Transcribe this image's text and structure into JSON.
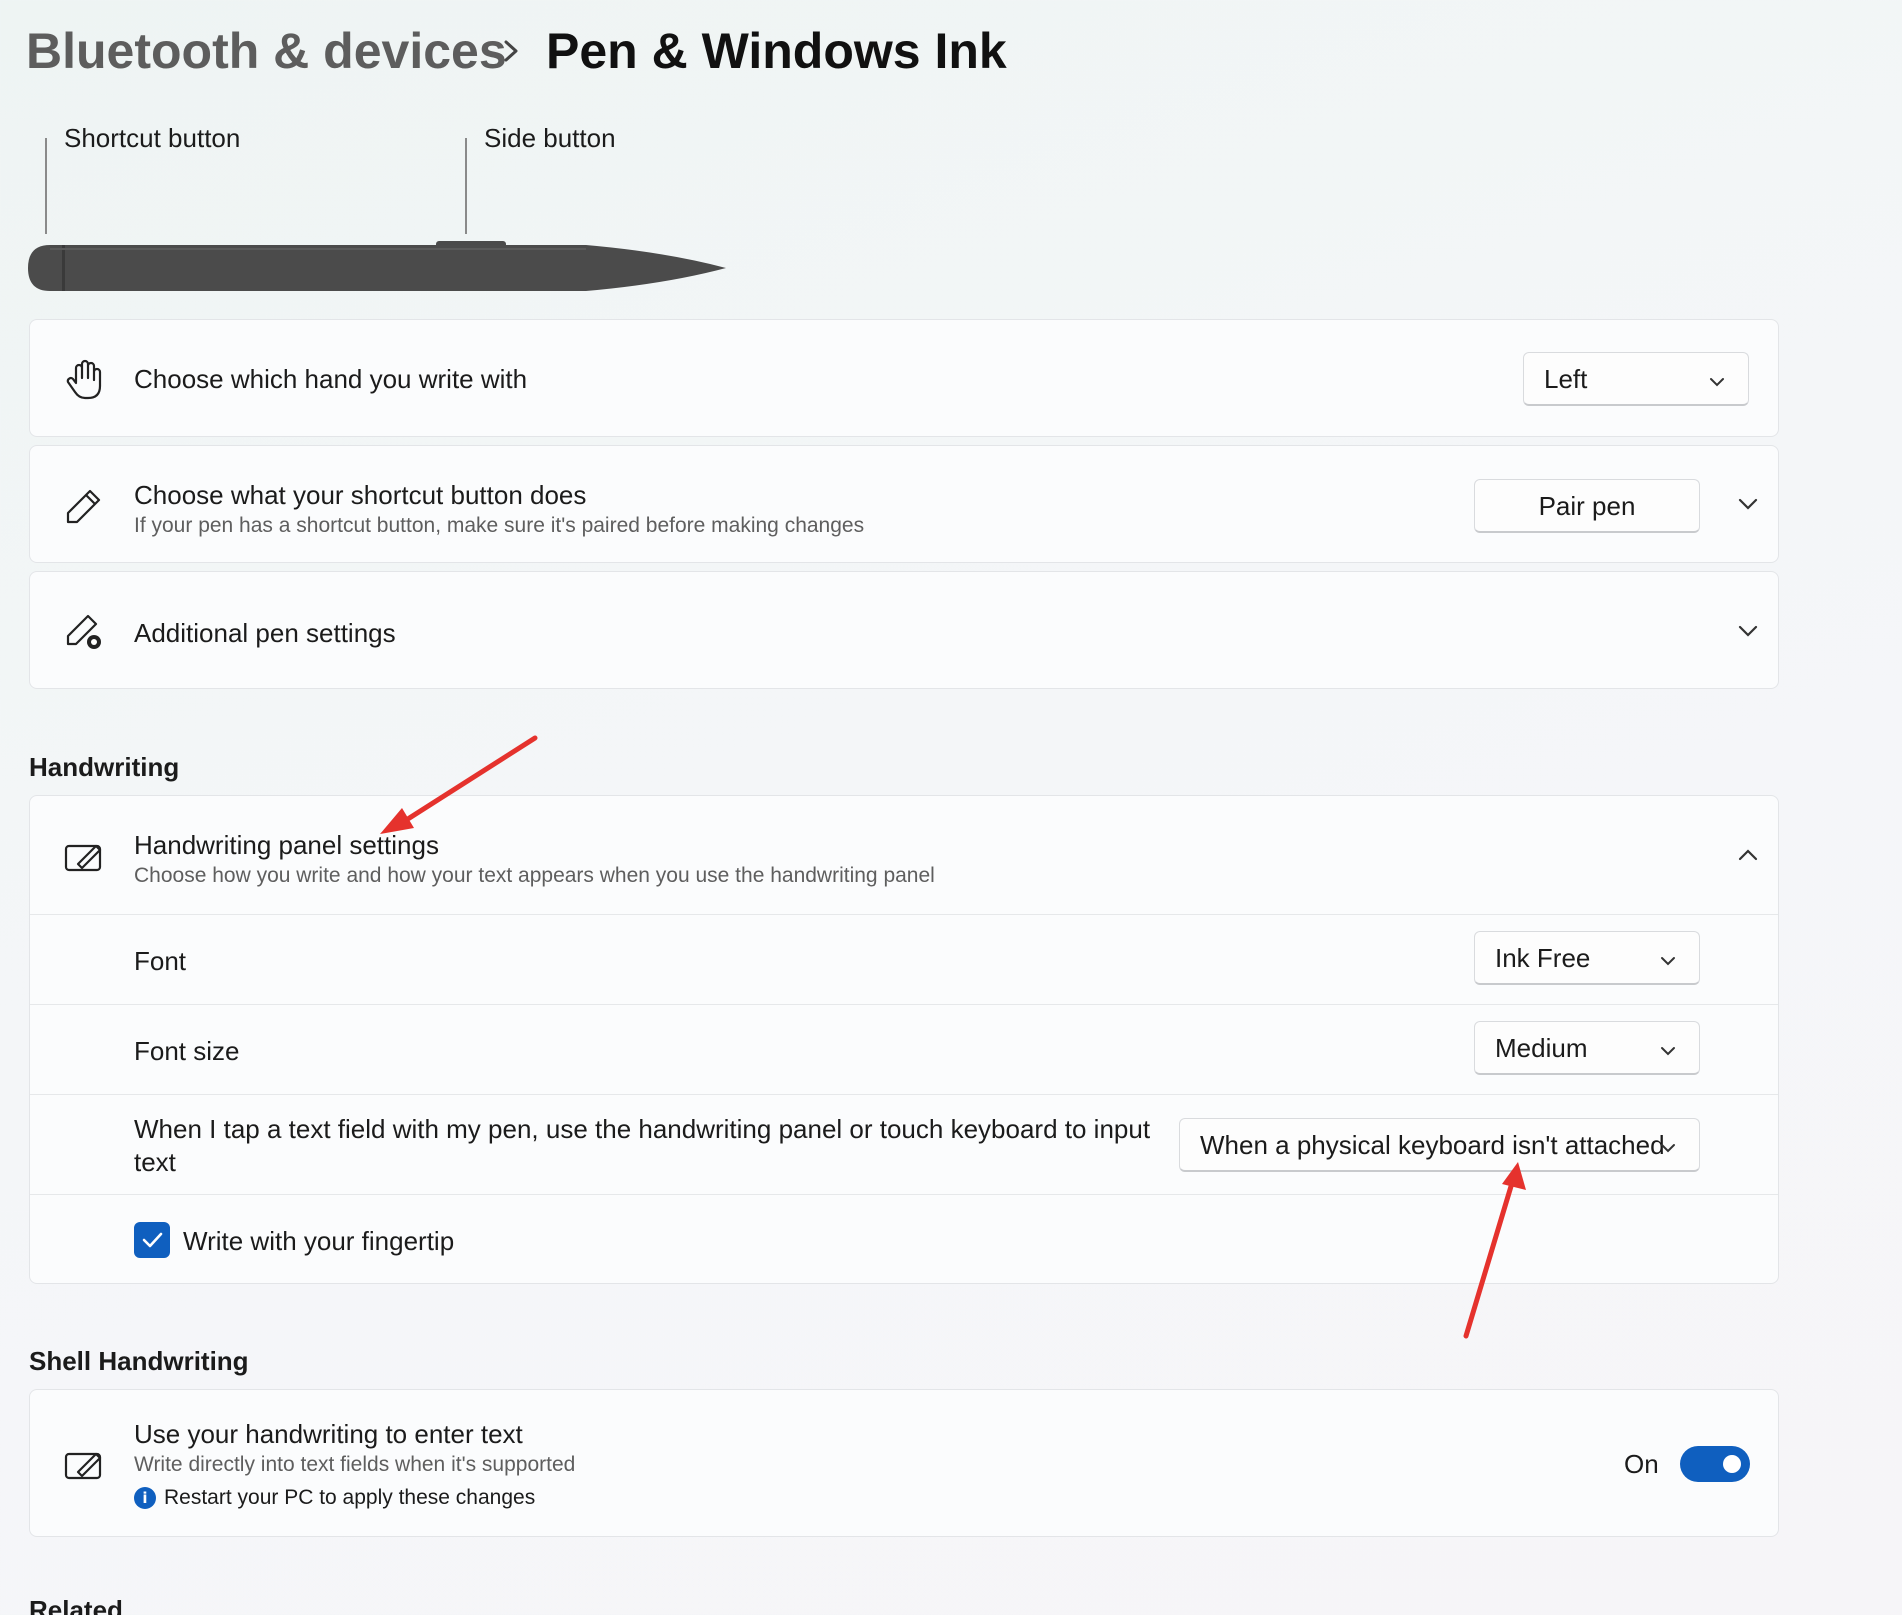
{
  "breadcrumb": {
    "parent": "Bluetooth & devices",
    "current": "Pen & Windows Ink"
  },
  "pen_illustration": {
    "shortcut_label": "Shortcut button",
    "side_label": "Side button"
  },
  "pen_settings": {
    "hand": {
      "title": "Choose which hand you write with",
      "value": "Left",
      "icon": "hand-icon"
    },
    "shortcut": {
      "title": "Choose what your shortcut button does",
      "description": "If your pen has a shortcut button, make sure it's paired before making changes",
      "button": "Pair pen",
      "icon": "pen-icon"
    },
    "additional": {
      "title": "Additional pen settings",
      "icon": "pen-gear-icon"
    }
  },
  "handwriting": {
    "heading": "Handwriting",
    "panel": {
      "title": "Handwriting panel settings",
      "description": "Choose how you write and how your text appears when you use the handwriting panel",
      "icon": "handwriting-panel-icon"
    },
    "font": {
      "label": "Font",
      "value": "Ink Free"
    },
    "font_size": {
      "label": "Font size",
      "value": "Medium"
    },
    "tap_field": {
      "label_line1": "When I tap a text field with my pen, use the handwriting panel or touch keyboard to input",
      "label_line2": "text",
      "value": "When a physical keyboard isn't attached"
    },
    "fingertip": {
      "label": "Write with your fingertip",
      "checked": true
    }
  },
  "shell_handwriting": {
    "heading": "Shell Handwriting",
    "title": "Use your handwriting to enter text",
    "description": "Write directly into text fields when it's supported",
    "note": "Restart your PC to apply these changes",
    "toggle_label": "On",
    "toggle_on": true,
    "icon": "handwriting-panel-icon"
  },
  "related": {
    "heading": "Related"
  },
  "colors": {
    "accent": "#0f5fbf",
    "annotation": "#e5322d"
  }
}
